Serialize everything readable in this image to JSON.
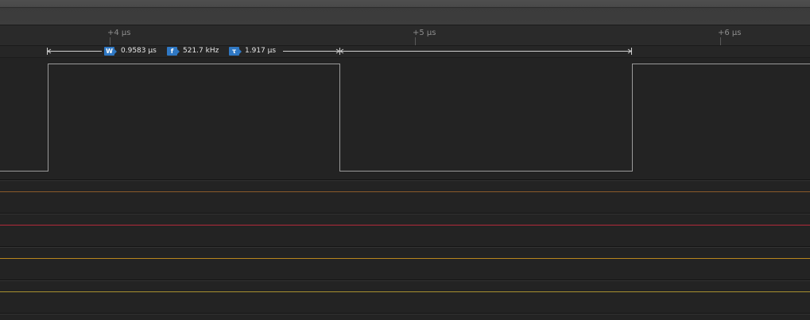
{
  "timeline": {
    "ticks": [
      {
        "label": "+4 µs"
      },
      {
        "label": "+5 µs"
      },
      {
        "label": "+6 µs"
      }
    ]
  },
  "measurement": {
    "width_icon": "W",
    "width_value": "0.9583 µs",
    "frequency_icon": "f",
    "frequency_value": "521.7 kHz",
    "period_icon": "τ",
    "period_value": "1.917 µs"
  },
  "channels": [
    {
      "id": "ch0",
      "type": "digital-waveform",
      "line_color": "#9a9a9a"
    },
    {
      "id": "ch1",
      "type": "flat",
      "line_color": "#8a5a2a"
    },
    {
      "id": "ch2",
      "type": "flat",
      "line_color": "#b22a3a"
    },
    {
      "id": "ch3",
      "type": "flat",
      "line_color": "#b8861e"
    },
    {
      "id": "ch4",
      "type": "flat",
      "line_color": "#a89030"
    }
  ]
}
